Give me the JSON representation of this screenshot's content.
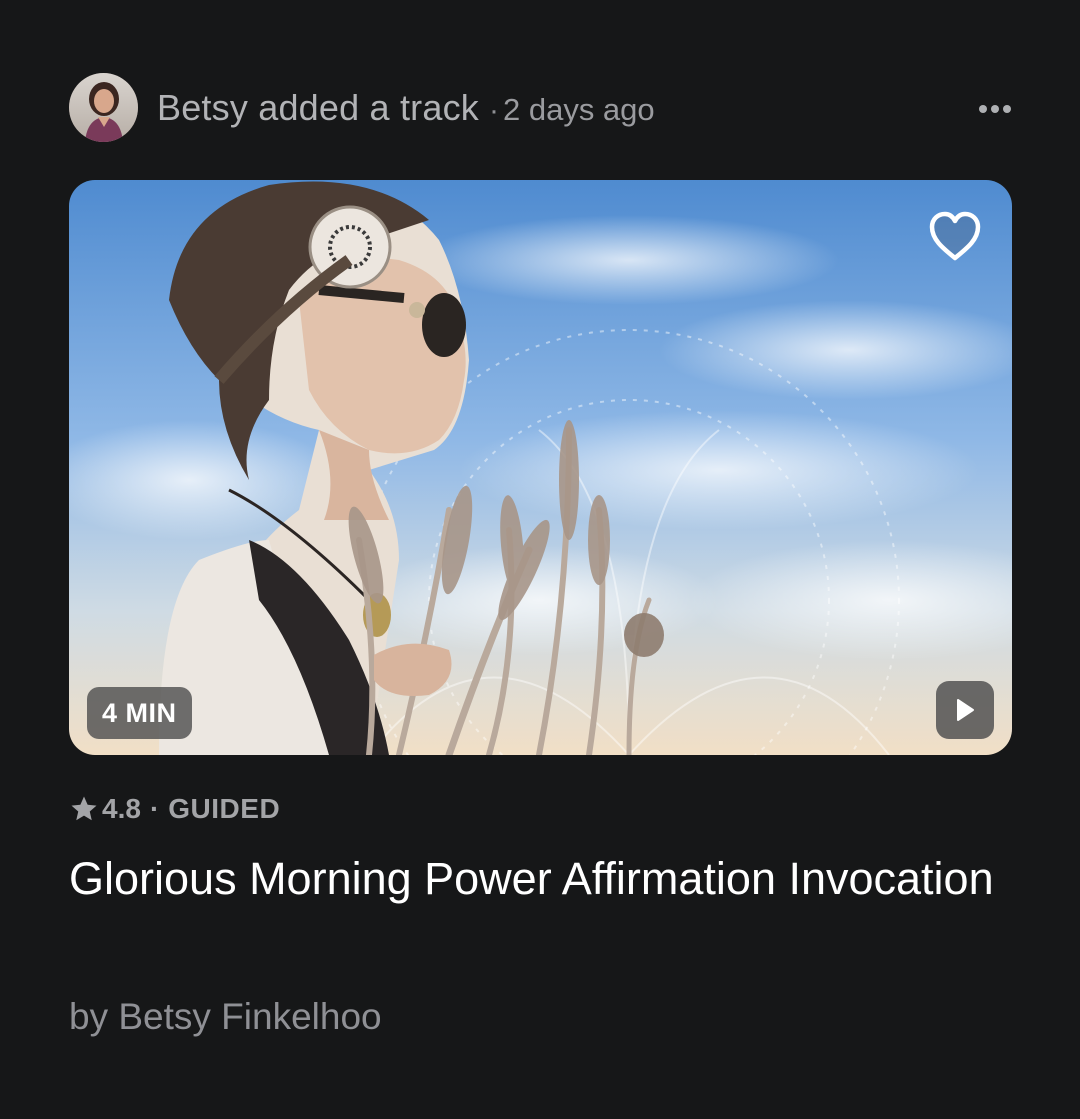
{
  "activity": {
    "actor_action": "Betsy added a track",
    "separator": "·",
    "timestamp": "2 days ago",
    "avatar_icon": "user-avatar-photo",
    "more_icon": "more-horizontal-icon"
  },
  "track": {
    "duration_badge": "4 MIN",
    "favorite_icon": "heart-outline-icon",
    "play_icon": "play-icon",
    "rating": "4.8",
    "rating_icon": "star-icon",
    "meta_separator": "·",
    "type": "GUIDED",
    "title": "Glorious Morning Power Affirmation Invocation",
    "byline": "by Betsy Finkelhoo"
  },
  "colors": {
    "background": "#161718",
    "text_primary": "#ffffff",
    "text_secondary": "#a3a4a7",
    "sky_top": "#5d92d2",
    "sky_horizon": "#f1e2cf"
  }
}
